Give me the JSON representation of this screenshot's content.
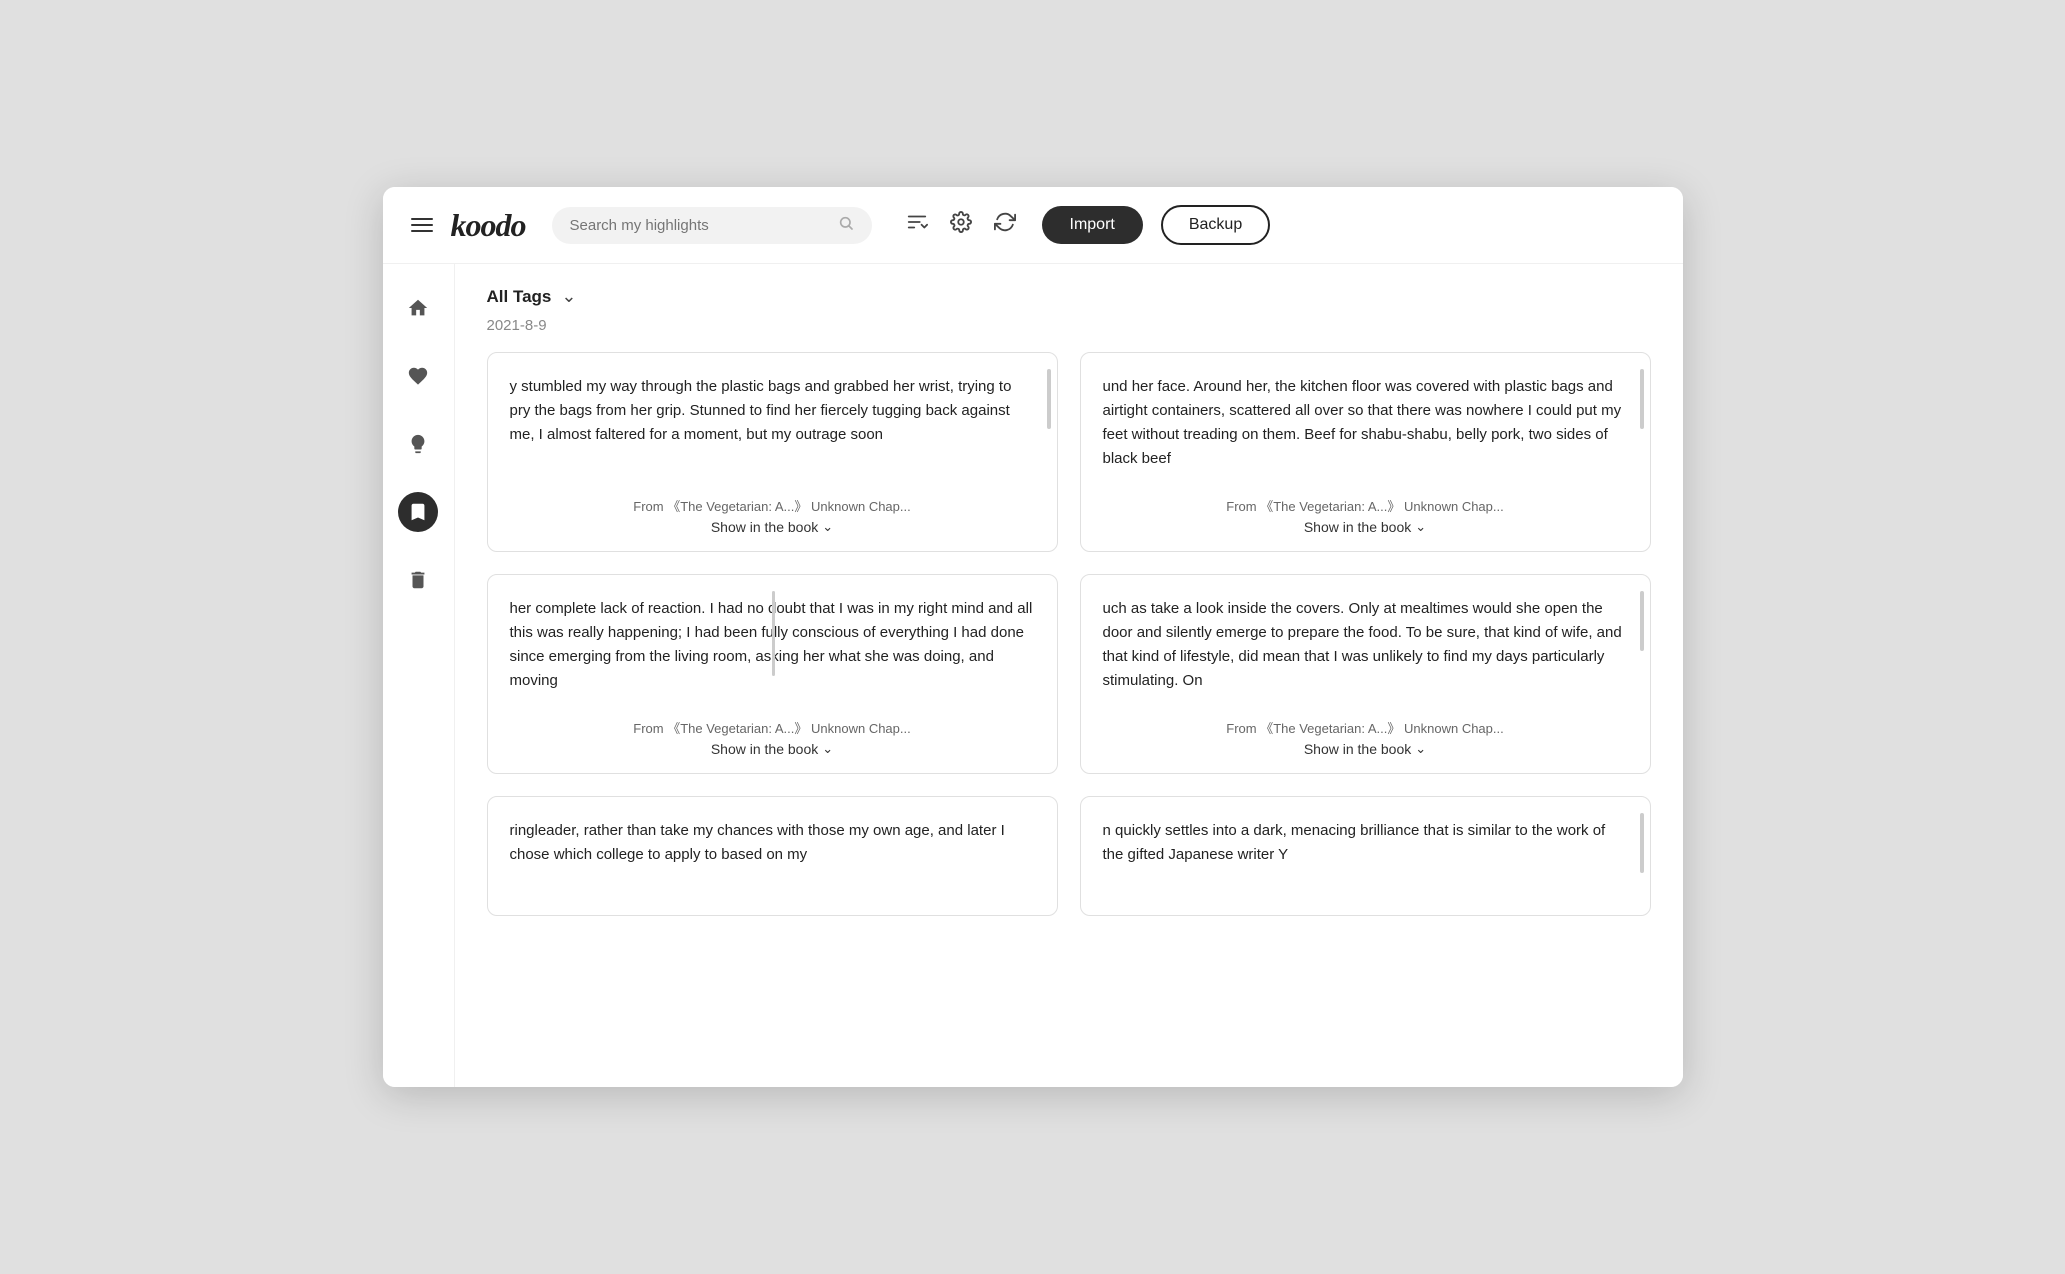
{
  "header": {
    "logo": "koodo",
    "search_placeholder": "Search my highlights",
    "import_label": "Import",
    "backup_label": "Backup",
    "icons": [
      {
        "name": "sort-icon",
        "symbol": "↕"
      },
      {
        "name": "settings-icon",
        "symbol": "⚙"
      },
      {
        "name": "refresh-icon",
        "symbol": "↻"
      }
    ]
  },
  "sidebar": {
    "items": [
      {
        "name": "home",
        "symbol": "🏠",
        "active": false
      },
      {
        "name": "favorites",
        "symbol": "♥",
        "active": false
      },
      {
        "name": "ideas",
        "symbol": "💡",
        "active": false
      },
      {
        "name": "bookmarks",
        "symbol": "🔖",
        "active": true
      },
      {
        "name": "trash",
        "symbol": "🗑",
        "active": false
      }
    ]
  },
  "content": {
    "tags_label": "All Tags",
    "date_label": "2021-8-9",
    "cards": [
      {
        "id": 1,
        "text": "y stumbled my way through the plastic bags and grabbed her wrist, trying to pry the bags from her grip. Stunned to find her fiercely tugging back against me, I almost faltered for a moment, but my outrage soon",
        "source": "From 《The Vegetarian: A...》 Unknown Chap...",
        "show_label": "Show in the book",
        "has_right_scrollbar": true,
        "has_left_divider": false
      },
      {
        "id": 2,
        "text": "und her face. Around her, the kitchen floor was covered with plastic bags and airtight containers, scattered all over so that there was nowhere I could put my feet without treading on them. Beef for shabu-shabu, belly pork, two sides of black beef",
        "source": "From 《The Vegetarian: A...》 Unknown Chap...",
        "show_label": "Show in the book",
        "has_right_scrollbar": true,
        "has_left_divider": false
      },
      {
        "id": 3,
        "text": "her complete lack of reaction. I had no doubt that I was in my right mind and all this was really happening; I had been fully conscious of everything I had done since emerging from the living room, asking her what she was doing, and moving",
        "source": "From 《The Vegetarian: A...》 Unknown Chap...",
        "show_label": "Show in the book",
        "has_right_scrollbar": false,
        "has_left_divider": true
      },
      {
        "id": 4,
        "text": "uch as take a look inside the covers. Only at mealtimes would she open the door and silently emerge to prepare the food. To be sure, that kind of wife, and that kind of lifestyle, did mean that I was unlikely to find my days particularly stimulating. On",
        "source": "From 《The Vegetarian: A...》 Unknown Chap...",
        "show_label": "Show in the book",
        "has_right_scrollbar": true,
        "has_left_divider": false
      },
      {
        "id": 5,
        "text": "ringleader, rather than take my chances with those my own age, and later I chose which college to apply to based on my",
        "source": "",
        "show_label": "",
        "has_right_scrollbar": false,
        "has_left_divider": false,
        "partial": true
      },
      {
        "id": 6,
        "text": "n quickly settles into a dark, menacing brilliance that is similar to the work of the gifted Japanese writer Y",
        "source": "",
        "show_label": "",
        "has_right_scrollbar": true,
        "has_left_divider": false,
        "partial": true
      }
    ]
  }
}
